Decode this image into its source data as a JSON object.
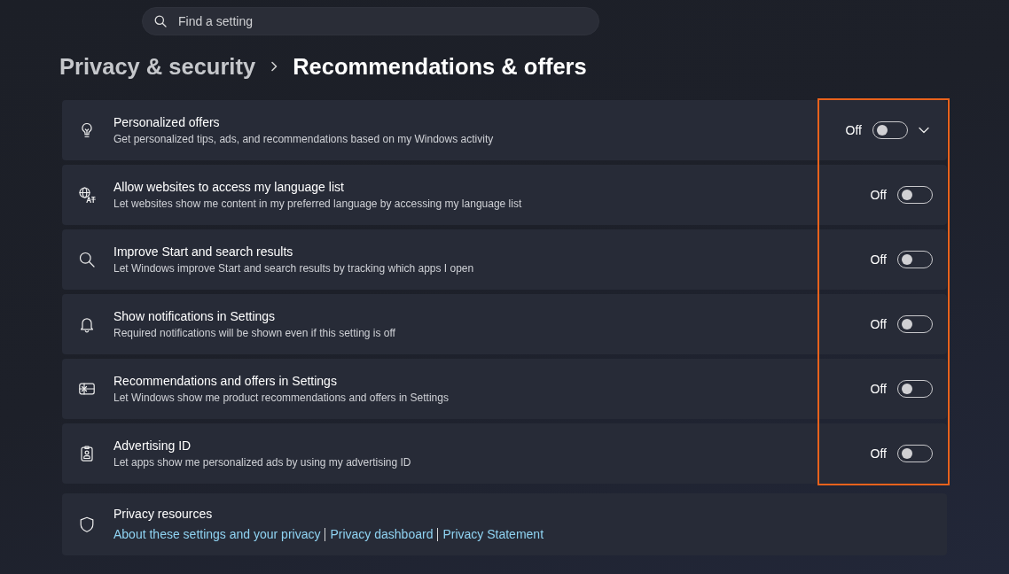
{
  "search": {
    "placeholder": "Find a setting"
  },
  "breadcrumb": [
    {
      "label": "Privacy & security",
      "current": false
    },
    {
      "label": "Recommendations & offers",
      "current": true
    }
  ],
  "settings": [
    {
      "kind": "expander",
      "title": "Personalized offers",
      "description": "Get personalized tips, ads, and recommendations based on my Windows activity",
      "state_label": "Off",
      "on": false,
      "expanded": false
    },
    {
      "kind": "toggle",
      "title": "Allow websites to access my language list",
      "description": "Let websites show me content in my preferred language by accessing my language list",
      "state_label": "Off",
      "on": false
    },
    {
      "kind": "toggle",
      "title": "Improve Start and search results",
      "description": "Let Windows improve Start and search results by tracking which apps I open",
      "state_label": "Off",
      "on": false
    },
    {
      "kind": "toggle",
      "title": "Show notifications in Settings",
      "description": "Required notifications will be shown even if this setting is off",
      "state_label": "Off",
      "on": false
    },
    {
      "kind": "toggle",
      "title": "Recommendations and offers in Settings",
      "description": "Let Windows show me product recommendations and offers in Settings",
      "state_label": "Off",
      "on": false
    },
    {
      "kind": "toggle",
      "title": "Advertising ID",
      "description": "Let apps show me personalized ads by using my advertising ID",
      "state_label": "Off",
      "on": false
    }
  ],
  "toggles_outlined": true,
  "resources": {
    "title": "Privacy resources",
    "links": [
      "About these settings and your privacy",
      "Privacy dashboard",
      "Privacy Statement"
    ]
  }
}
